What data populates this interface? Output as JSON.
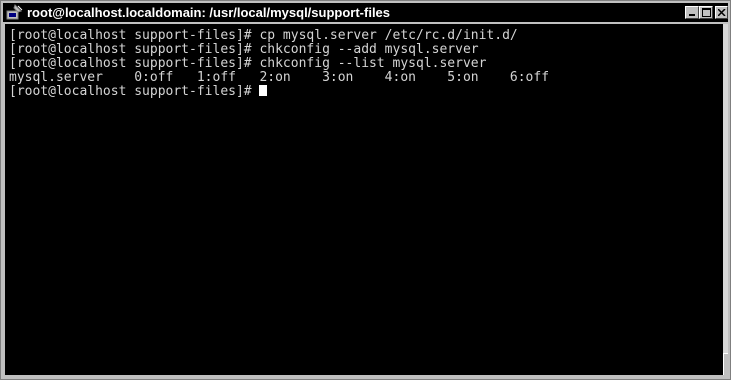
{
  "window": {
    "title": "root@localhost.localdomain: /usr/local/mysql/support-files",
    "icon": "terminal-app-icon"
  },
  "terminal": {
    "lines": [
      "[root@localhost support-files]# cp mysql.server /etc/rc.d/init.d/",
      "[root@localhost support-files]# chkconfig --add mysql.server",
      "[root@localhost support-files]# chkconfig --list mysql.server",
      "mysql.server    0:off   1:off   2:on    3:on    4:on    5:on    6:off"
    ],
    "prompt": "[root@localhost support-files]# "
  },
  "colors": {
    "terminal_bg": "#000000",
    "terminal_fg": "#d4d4d4",
    "titlebar_bg": "#000000"
  }
}
